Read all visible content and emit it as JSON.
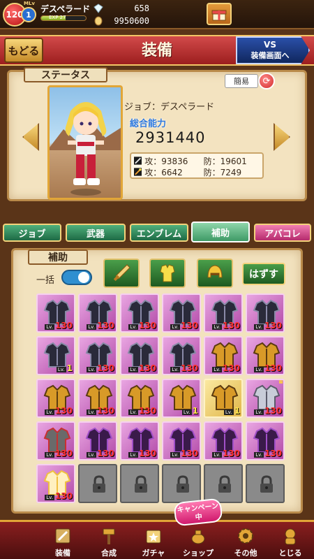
{
  "player": {
    "level": "120",
    "master_level_label": "MLv",
    "master_level": "1",
    "name": "デスペラード",
    "exp_label": "EXP 27",
    "exp_fraction": 0.55
  },
  "currency": [
    {
      "icon": "gem-icon",
      "value": "658"
    },
    {
      "icon": "gold-coin-icon",
      "value": "9950600"
    }
  ],
  "header": {
    "back_label": "もどる",
    "title": "装備",
    "vs_line1": "VS",
    "vs_line2": "装備画面へ"
  },
  "status": {
    "section_label": "ステータス",
    "easy_label": "簡易",
    "job_text": "ジョブ：デスペラード",
    "power_label": "総合能力",
    "power_value": "2931440",
    "physical": {
      "atk_label": "攻：",
      "atk": "93836",
      "def_label": "防：",
      "def": "19601"
    },
    "magic": {
      "atk_label": "攻：",
      "atk": "6642",
      "def_label": "防：",
      "def": "7249"
    }
  },
  "tabs": [
    {
      "label": "ジョブ",
      "active": false
    },
    {
      "label": "武器",
      "active": false
    },
    {
      "label": "エンブレム",
      "active": false
    },
    {
      "label": "補助",
      "active": true
    },
    {
      "label": "アバコレ",
      "active": false
    }
  ],
  "equip": {
    "section_label": "補助",
    "bulk_label": "一括",
    "bulk_on": true,
    "remove_label": "はずす",
    "filters": [
      "sword-icon",
      "body-armor-icon",
      "helmet-icon"
    ],
    "lv_prefix": "Lv.",
    "items": [
      {
        "kind": "purple",
        "armor": "dark",
        "lv": "130"
      },
      {
        "kind": "purple",
        "armor": "dark",
        "lv": "130"
      },
      {
        "kind": "purple",
        "armor": "dark",
        "lv": "130"
      },
      {
        "kind": "purple",
        "armor": "dark",
        "lv": "130"
      },
      {
        "kind": "purple",
        "armor": "dark",
        "lv": "130"
      },
      {
        "kind": "purple",
        "armor": "dark",
        "lv": "130"
      },
      {
        "kind": "purple",
        "armor": "dark",
        "lv": "1"
      },
      {
        "kind": "purple",
        "armor": "dark",
        "lv": "130"
      },
      {
        "kind": "purple",
        "armor": "dark",
        "lv": "130"
      },
      {
        "kind": "purple",
        "armor": "dark",
        "lv": "130"
      },
      {
        "kind": "purple",
        "armor": "gold",
        "lv": "130"
      },
      {
        "kind": "purple",
        "armor": "gold",
        "lv": "130"
      },
      {
        "kind": "purple",
        "armor": "gold",
        "lv": "130"
      },
      {
        "kind": "purple",
        "armor": "gold",
        "lv": "130"
      },
      {
        "kind": "purple",
        "armor": "gold",
        "lv": "130"
      },
      {
        "kind": "purple",
        "armor": "gold",
        "lv": "1"
      },
      {
        "kind": "gold",
        "armor": "gold",
        "lv": "1"
      },
      {
        "kind": "purple",
        "armor": "silver",
        "lv": "130",
        "crown": true
      },
      {
        "kind": "purple",
        "armor": "red",
        "lv": "130"
      },
      {
        "kind": "purple",
        "armor": "violet",
        "lv": "130"
      },
      {
        "kind": "purple",
        "armor": "violet",
        "lv": "130"
      },
      {
        "kind": "purple",
        "armor": "violet",
        "lv": "130"
      },
      {
        "kind": "purple",
        "armor": "violet",
        "lv": "130"
      },
      {
        "kind": "purple",
        "armor": "violet",
        "lv": "130"
      },
      {
        "kind": "purple",
        "armor": "angel",
        "lv": "130"
      },
      {
        "kind": "locked"
      },
      {
        "kind": "locked"
      },
      {
        "kind": "locked"
      },
      {
        "kind": "locked"
      },
      {
        "kind": "locked"
      }
    ]
  },
  "campaign_badge": "キャンペーン中",
  "nav": [
    {
      "label": "装備",
      "icon": "equip-icon"
    },
    {
      "label": "合成",
      "icon": "hammer-icon"
    },
    {
      "label": "ガチャ",
      "icon": "gacha-icon"
    },
    {
      "label": "ショップ",
      "icon": "shop-icon"
    },
    {
      "label": "その他",
      "icon": "gear-icon"
    },
    {
      "label": "とじる",
      "icon": "close-menu-icon"
    }
  ]
}
